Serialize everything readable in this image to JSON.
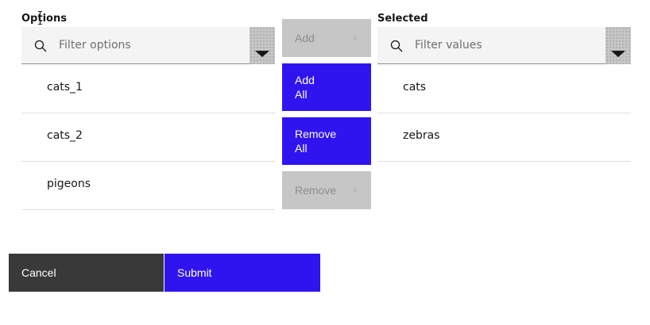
{
  "options": {
    "label": "Options",
    "filter_placeholder": "Filter options",
    "items": [
      "cats_1",
      "cats_2",
      "pigeons"
    ]
  },
  "selected": {
    "label": "Selected",
    "filter_placeholder": "Filter values",
    "items": [
      "cats",
      "zebras"
    ]
  },
  "transfer": {
    "add_label": "Add",
    "add_all_label": "Add\nAll",
    "remove_all_label": "Remove\nAll",
    "remove_label": "Remove"
  },
  "footer": {
    "cancel_label": "Cancel",
    "submit_label": "Submit"
  },
  "colors": {
    "primary": "#3014f0",
    "secondary": "#393939",
    "disabled": "#c6c6c6",
    "field": "#f4f4f4"
  },
  "icons": {
    "search": "search-icon",
    "dropdown": "caret-down-icon",
    "add": "chevron-right-icon",
    "remove": "chevron-left-icon",
    "cursor": "text-cursor-icon"
  }
}
